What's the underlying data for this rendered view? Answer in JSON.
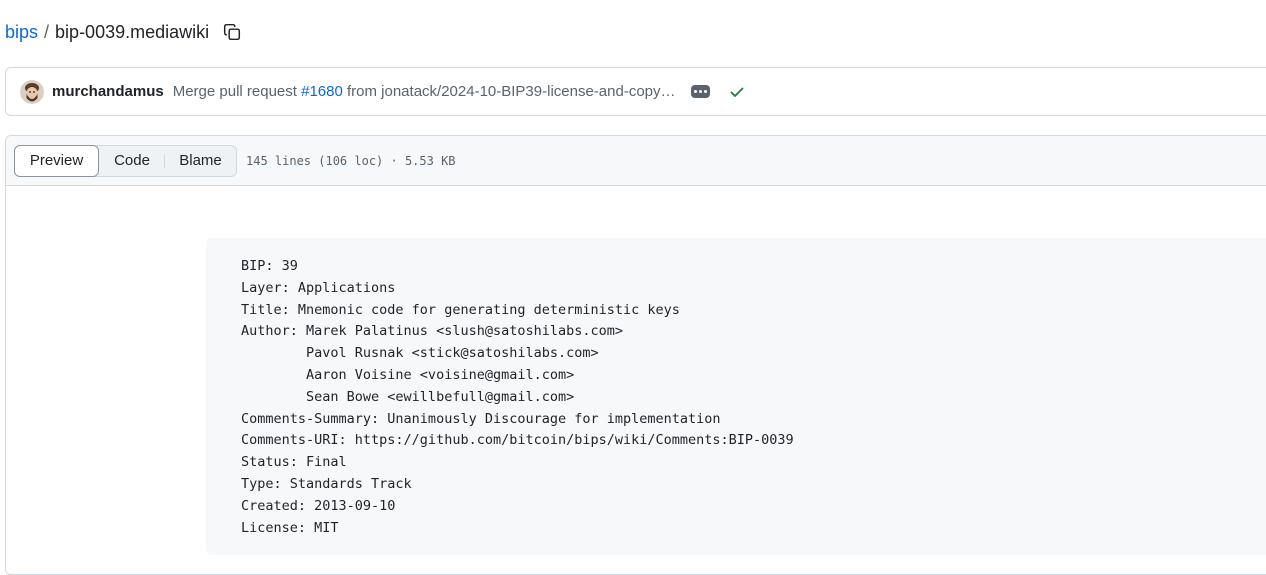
{
  "breadcrumb": {
    "repo": "bips",
    "separator": "/",
    "file": "bip-0039.mediawiki"
  },
  "icons": {
    "copy": "copy-icon",
    "more": "kebab-horizontal-icon",
    "check": "check-icon"
  },
  "commit": {
    "author": "murchandamus",
    "message_prefix": "Merge pull request",
    "pr_link": "#1680",
    "message_suffix": "from jonatack/2024-10-BIP39-license-and-copy…",
    "status_color": "#1a7f37"
  },
  "file": {
    "tabs": [
      "Preview",
      "Code",
      "Blame"
    ],
    "active_tab": "Preview",
    "meta": "145 lines (106 loc) · 5.53 KB"
  },
  "preamble": [
    "BIP: 39",
    "Layer: Applications",
    "Title: Mnemonic code for generating deterministic keys",
    "Author: Marek Palatinus <slush@satoshilabs.com>",
    "        Pavol Rusnak <stick@satoshilabs.com>",
    "        Aaron Voisine <voisine@gmail.com>",
    "        Sean Bowe <ewillbefull@gmail.com>",
    "Comments-Summary: Unanimously Discourage for implementation",
    "Comments-URI: https://github.com/bitcoin/bips/wiki/Comments:BIP-0039",
    "Status: Final",
    "Type: Standards Track",
    "Created: 2013-09-10",
    "License: MIT"
  ]
}
